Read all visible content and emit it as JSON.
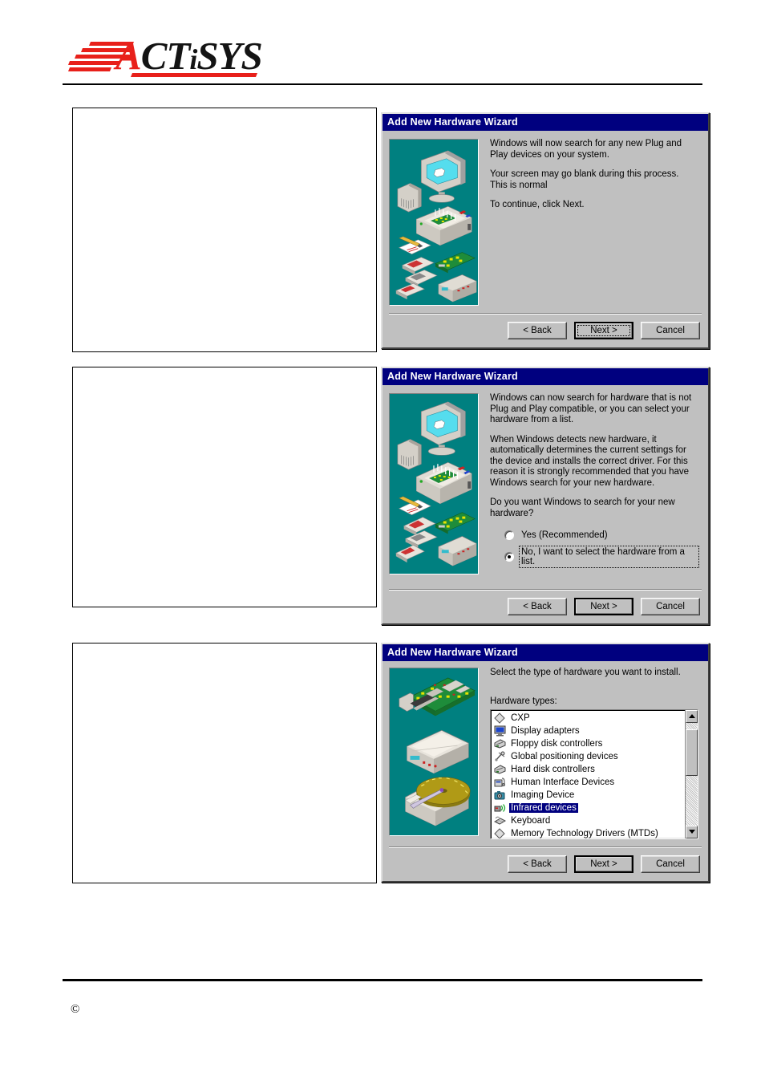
{
  "header": {
    "logo_text_a": "A",
    "logo_text_rest": "CT",
    "logo_text_i": "i",
    "logo_text_sys": "SYS",
    "logo_alt": "ACTiSYS"
  },
  "footer": {
    "copyright": "©"
  },
  "steps": [
    {
      "note": "",
      "dialog": {
        "title": "Add New Hardware Wizard",
        "art": "plug-and-play-hardware-illustration",
        "paragraphs": [
          "Windows will now search for any new Plug and Play devices on your system.",
          "Your screen may go blank during this process. This is normal",
          "To continue, click Next."
        ],
        "buttons": {
          "back": "< Back",
          "back_mnemonic": "B",
          "next": "Next >",
          "cancel": "Cancel"
        },
        "next_is_default": true,
        "next_has_focus": true
      }
    },
    {
      "note": "",
      "dialog": {
        "title": "Add New Hardware Wizard",
        "art": "plug-and-play-hardware-illustration",
        "paragraphs": [
          "Windows can now search for hardware that is not Plug and Play compatible, or you can select your hardware from a list.",
          "When Windows detects new hardware, it automatically determines the current settings for the device and installs the correct driver. For this reason it is strongly recommended that you have Windows search for your new hardware.",
          "Do you want Windows to search for your new hardware?"
        ],
        "radios": [
          {
            "label": "Yes (Recommended)",
            "mnemonic": "Y",
            "selected": false,
            "focused": false
          },
          {
            "label": "No, I want to select the hardware from a list.",
            "mnemonic": "N",
            "selected": true,
            "focused": true
          }
        ],
        "buttons": {
          "back": "< Back",
          "back_mnemonic": "B",
          "next": "Next >",
          "cancel": "Cancel"
        },
        "next_is_default": true,
        "next_has_focus": false
      }
    },
    {
      "note": "",
      "dialog": {
        "title": "Add New Hardware Wizard",
        "art": "expansion-card-modem-harddisk-illustration",
        "prompt": "Select the type of hardware you want to install.",
        "list_label": "Hardware types:",
        "list_label_mnemonic": "H",
        "list_items": [
          {
            "label": "CXP",
            "icon": "generic-device-icon",
            "selected": false
          },
          {
            "label": "Display adapters",
            "icon": "monitor-icon",
            "selected": false
          },
          {
            "label": "Floppy disk controllers",
            "icon": "controller-icon",
            "selected": false
          },
          {
            "label": "Global positioning devices",
            "icon": "satellite-icon",
            "selected": false
          },
          {
            "label": "Hard disk controllers",
            "icon": "controller-icon",
            "selected": false
          },
          {
            "label": "Human Interface Devices",
            "icon": "hid-icon",
            "selected": false
          },
          {
            "label": "Imaging Device",
            "icon": "camera-icon",
            "selected": false
          },
          {
            "label": "Infrared devices",
            "icon": "infrared-icon",
            "selected": true
          },
          {
            "label": "Keyboard",
            "icon": "keyboard-icon",
            "selected": false
          },
          {
            "label": "Memory Technology Drivers (MTDs)",
            "icon": "generic-device-icon",
            "selected": false
          }
        ],
        "scrollbar": {
          "up": "scroll-up-arrow",
          "down": "scroll-down-arrow"
        },
        "buttons": {
          "back": "< Back",
          "back_mnemonic": "B",
          "next": "Next >",
          "cancel": "Cancel"
        },
        "next_is_default": true,
        "next_has_focus": false
      }
    }
  ],
  "colors": {
    "titlebar": "#00007f",
    "dialog_face": "#c0c0c0",
    "art_background": "#008080",
    "brand_red": "#e8201a",
    "selection": "#00007f"
  }
}
